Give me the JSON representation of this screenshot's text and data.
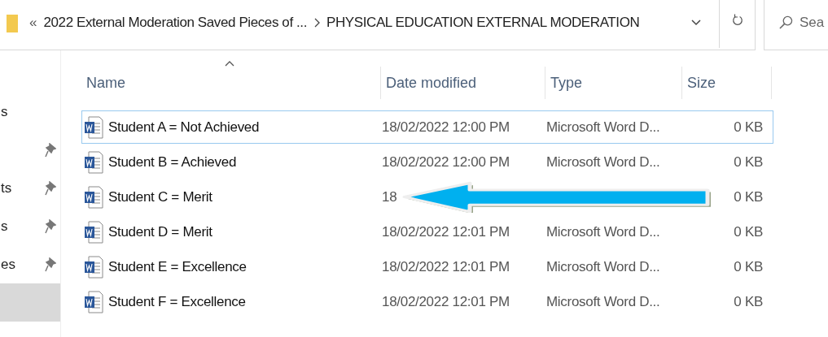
{
  "address_bar": {
    "overflow": "«",
    "crumbs": [
      "2022 External Moderation Saved Pieces of ...",
      "PHYSICAL EDUCATION EXTERNAL MODERATION"
    ]
  },
  "search": {
    "placeholder": "Sea"
  },
  "sidebar": {
    "items": [
      {
        "label": "s",
        "pinned": false,
        "selected": false
      },
      {
        "pinned": true,
        "selected": false
      },
      {
        "label": "ts",
        "pinned": true,
        "selected": false
      },
      {
        "label": "s",
        "pinned": true,
        "selected": false
      },
      {
        "label": "es",
        "pinned": true,
        "selected": false
      },
      {
        "pinned": false,
        "selected": true
      }
    ]
  },
  "table": {
    "columns": [
      "Name",
      "Date modified",
      "Type",
      "Size"
    ],
    "rows": [
      {
        "name": "Student A = Not Achieved",
        "date": "18/02/2022 12:00 PM",
        "type": "Microsoft Word D...",
        "size": "0 KB",
        "selected": true,
        "pointed_at": false
      },
      {
        "name": "Student B = Achieved",
        "date": "18/02/2022 12:00 PM",
        "type": "Microsoft Word D...",
        "size": "0 KB",
        "selected": false,
        "pointed_at": false
      },
      {
        "name": "Student C = Merit",
        "date": "18",
        "size": "0 KB",
        "selected": false,
        "pointed_at": true
      },
      {
        "name": "Student D = Merit",
        "date": "18/02/2022 12:01 PM",
        "type": "Microsoft Word D...",
        "size": "0 KB",
        "selected": false,
        "pointed_at": false
      },
      {
        "name": "Student E = Excellence",
        "date": "18/02/2022 12:01 PM",
        "type": "Microsoft Word D...",
        "size": "0 KB",
        "selected": false,
        "pointed_at": false
      },
      {
        "name": "Student F = Excellence",
        "date": "18/02/2022 12:01 PM",
        "type": "Microsoft Word D...",
        "size": "0 KB",
        "selected": false,
        "pointed_at": false
      }
    ]
  }
}
